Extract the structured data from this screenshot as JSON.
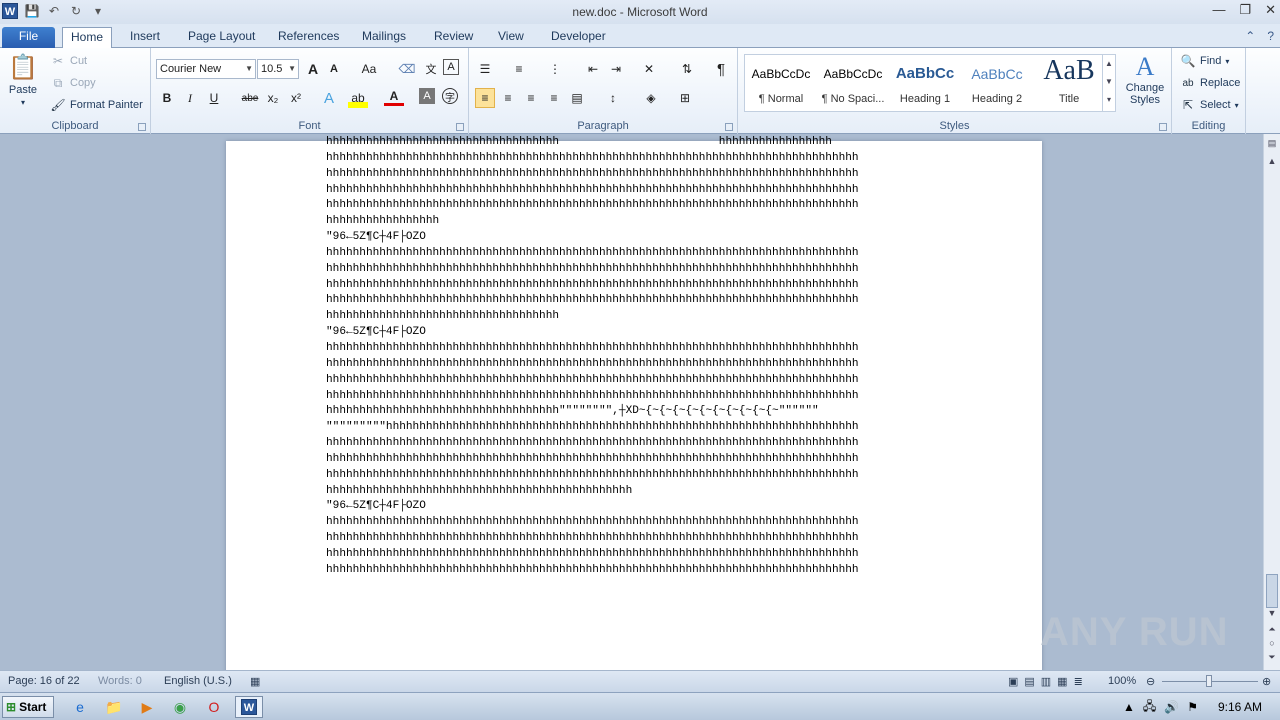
{
  "window": {
    "title": "new.doc - Microsoft Word"
  },
  "tabs": [
    {
      "label": "File"
    },
    {
      "label": "Home"
    },
    {
      "label": "Insert"
    },
    {
      "label": "Page Layout"
    },
    {
      "label": "References"
    },
    {
      "label": "Mailings"
    },
    {
      "label": "Review"
    },
    {
      "label": "View"
    },
    {
      "label": "Developer"
    }
  ],
  "clipboard": {
    "paste": "Paste",
    "cut": "Cut",
    "copy": "Copy",
    "format_painter": "Format Painter",
    "label": "Clipboard"
  },
  "font": {
    "family": "Courier New",
    "size": "10.5",
    "label": "Font",
    "bold": "B",
    "italic": "I",
    "underline": "U",
    "strike": "abe",
    "sub": "x₂",
    "sup": "x²",
    "grow": "A",
    "shrink": "A",
    "case": "Aa",
    "color_a": "A"
  },
  "paragraph": {
    "label": "Paragraph",
    "pilcrow": "¶"
  },
  "styles": {
    "label": "Styles",
    "items": [
      {
        "preview": "AaBbCcDc",
        "name": "¶ Normal"
      },
      {
        "preview": "AaBbCcDc",
        "name": "¶ No Spaci..."
      },
      {
        "preview": "AaBbCc",
        "name": "Heading 1"
      },
      {
        "preview": "AaBbCc",
        "name": "Heading 2"
      },
      {
        "preview": "AaB",
        "name": "Title"
      }
    ],
    "change_styles": "Change Styles",
    "change_styles_icon_letter": "A"
  },
  "editing": {
    "label": "Editing",
    "find": "Find",
    "replace": "Replace",
    "select": "Select"
  },
  "document": {
    "lines": [
      "hhhhhhhhhhhhhhhhhhhhhhhhhhhhhhhhhhh                        hhhhhhhhhhhhhhhhh",
      "hhhhhhhhhhhhhhhhhhhhhhhhhhhhhhhhhhhhhhhhhhhhhhhhhhhhhhhhhhhhhhhhhhhhhhhhhhhhhhhh",
      "hhhhhhhhhhhhhhhhhhhhhhhhhhhhhhhhhhhhhhhhhhhhhhhhhhhhhhhhhhhhhhhhhhhhhhhhhhhhhhhh",
      "hhhhhhhhhhhhhhhhhhhhhhhhhhhhhhhhhhhhhhhhhhhhhhhhhhhhhhhhhhhhhhhhhhhhhhhhhhhhhhhh",
      "hhhhhhhhhhhhhhhhhhhhhhhhhhhhhhhhhhhhhhhhhhhhhhhhhhhhhhhhhhhhhhhhhhhhhhhhhhhhhhhh",
      "hhhhhhhhhhhhhhhhh",
      "\"96←5Z¶C┼4F├OZO",
      "hhhhhhhhhhhhhhhhhhhhhhhhhhhhhhhhhhhhhhhhhhhhhhhhhhhhhhhhhhhhhhhhhhhhhhhhhhhhhhhh",
      "hhhhhhhhhhhhhhhhhhhhhhhhhhhhhhhhhhhhhhhhhhhhhhhhhhhhhhhhhhhhhhhhhhhhhhhhhhhhhhhh",
      "hhhhhhhhhhhhhhhhhhhhhhhhhhhhhhhhhhhhhhhhhhhhhhhhhhhhhhhhhhhhhhhhhhhhhhhhhhhhhhhh",
      "hhhhhhhhhhhhhhhhhhhhhhhhhhhhhhhhhhhhhhhhhhhhhhhhhhhhhhhhhhhhhhhhhhhhhhhhhhhhhhhh",
      "hhhhhhhhhhhhhhhhhhhhhhhhhhhhhhhhhhh",
      "\"96←5Z¶C┼4F├OZO",
      "hhhhhhhhhhhhhhhhhhhhhhhhhhhhhhhhhhhhhhhhhhhhhhhhhhhhhhhhhhhhhhhhhhhhhhhhhhhhhhhh",
      "hhhhhhhhhhhhhhhhhhhhhhhhhhhhhhhhhhhhhhhhhhhhhhhhhhhhhhhhhhhhhhhhhhhhhhhhhhhhhhhh",
      "hhhhhhhhhhhhhhhhhhhhhhhhhhhhhhhhhhhhhhhhhhhhhhhhhhhhhhhhhhhhhhhhhhhhhhhhhhhhhhhh",
      "hhhhhhhhhhhhhhhhhhhhhhhhhhhhhhhhhhhhhhhhhhhhhhhhhhhhhhhhhhhhhhhhhhhhhhhhhhhhhhhh",
      "hhhhhhhhhhhhhhhhhhhhhhhhhhhhhhhhhhh\"\"\"\"\"\"\"\",┼XD~{~{~{~{~{~{~{~{~{~{~\"\"\"\"\"\"",
      "\"\"\"\"\"\"\"\"\"hhhhhhhhhhhhhhhhhhhhhhhhhhhhhhhhhhhhhhhhhhhhhhhhhhhhhhhhhhhhhhhhhhhhhhh",
      "hhhhhhhhhhhhhhhhhhhhhhhhhhhhhhhhhhhhhhhhhhhhhhhhhhhhhhhhhhhhhhhhhhhhhhhhhhhhhhhh",
      "hhhhhhhhhhhhhhhhhhhhhhhhhhhhhhhhhhhhhhhhhhhhhhhhhhhhhhhhhhhhhhhhhhhhhhhhhhhhhhhh",
      "hhhhhhhhhhhhhhhhhhhhhhhhhhhhhhhhhhhhhhhhhhhhhhhhhhhhhhhhhhhhhhhhhhhhhhhhhhhhhhhh",
      "hhhhhhhhhhhhhhhhhhhhhhhhhhhhhhhhhhhhhhhhhhhhhh",
      "\"96←5Z¶C┼4F├OZO",
      "hhhhhhhhhhhhhhhhhhhhhhhhhhhhhhhhhhhhhhhhhhhhhhhhhhhhhhhhhhhhhhhhhhhhhhhhhhhhhhhh",
      "hhhhhhhhhhhhhhhhhhhhhhhhhhhhhhhhhhhhhhhhhhhhhhhhhhhhhhhhhhhhhhhhhhhhhhhhhhhhhhhh",
      "hhhhhhhhhhhhhhhhhhhhhhhhhhhhhhhhhhhhhhhhhhhhhhhhhhhhhhhhhhhhhhhhhhhhhhhhhhhhhhhh",
      "hhhhhhhhhhhhhhhhhhhhhhhhhhhhhhhhhhhhhhhhhhhhhhhhhhhhhhhhhhhhhhhhhhhhhhhhhhhhhhhh"
    ]
  },
  "status": {
    "page": "Page: 16 of 22",
    "words": "Words: 0",
    "language": "English (U.S.)",
    "zoom": "100%"
  },
  "taskbar": {
    "start": "Start",
    "time": "9:16 AM"
  },
  "watermark": "ANY RUN"
}
